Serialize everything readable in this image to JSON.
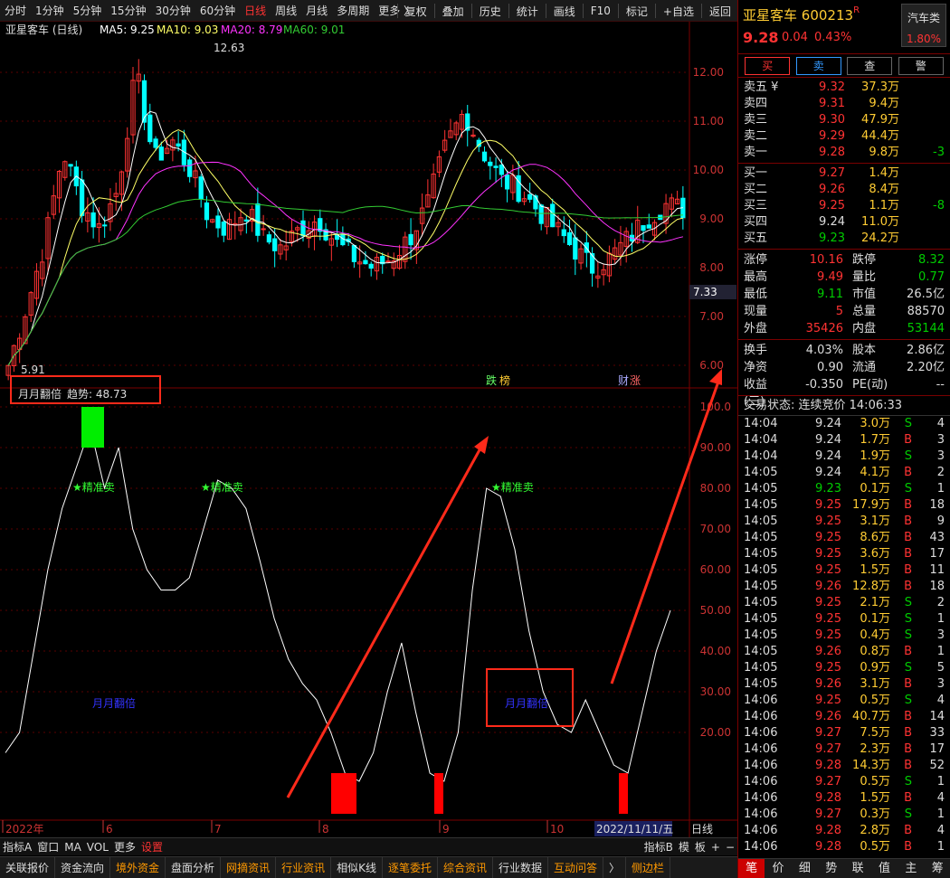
{
  "toolbar": {
    "periods": [
      "分时",
      "1分钟",
      "5分钟",
      "15分钟",
      "30分钟",
      "60分钟",
      "日线",
      "周线",
      "月线",
      "多周期",
      "更多 〉"
    ],
    "active_period": "日线",
    "actions": [
      "复权",
      "叠加",
      "历史",
      "统计",
      "画线",
      "F10",
      "标记",
      "+自选",
      "返回"
    ]
  },
  "chart_title": {
    "name": "亚星客车 (日线)",
    "ma5": "MA5: 9.25",
    "ma10": "MA10: 9.03",
    "ma20": "MA20: 8.79",
    "ma60": "MA60: 9.01"
  },
  "indicator_title": {
    "name": "月月翻倍",
    "trend": "趋势: 48.73"
  },
  "chart_labels": {
    "high": "12.63",
    "low": "5.91",
    "last_tag": "7.33",
    "sell1": "★精准卖",
    "sell2": "★精准卖",
    "sell3": "★精准卖",
    "ind1": "月月翻倍",
    "ind2": "月月翻倍",
    "news1": "跌",
    "news2": "榜",
    "news3": "财",
    "news4": "涨"
  },
  "xaxis": {
    "labels": [
      "2022年",
      "6",
      "7",
      "8",
      "9",
      "10"
    ],
    "date_box": "2022/11/11/五",
    "period": "日线"
  },
  "price_axis": [
    "12.00",
    "11.00",
    "10.00",
    "9.00",
    "8.00",
    "7.00",
    "6.00"
  ],
  "ind_axis": [
    "100.0",
    "90.00",
    "80.00",
    "70.00",
    "60.00",
    "50.00",
    "40.00",
    "30.00",
    "20.00"
  ],
  "colors": {
    "up": "#ff3333",
    "down": "#00ffff",
    "ma5": "#ffffff",
    "ma10": "#ffff66",
    "ma20": "#ff33ff",
    "ma60": "#33cc33",
    "annotation": "#ff2a1a"
  },
  "bottom_toolbar": {
    "items": [
      "指标A",
      "窗口",
      "MA",
      "VOL",
      "更多",
      "设置"
    ],
    "right": [
      "指标B",
      "模",
      "板",
      "+",
      "−"
    ]
  },
  "bottom_tabs": [
    "关联报价",
    "资金流向",
    "境外资金",
    "盘面分析",
    "网摘资讯",
    "行业资讯",
    "相似K线",
    "逐笔委托",
    "综合资讯",
    "行业数据",
    "互动问答",
    "〉",
    "侧边栏"
  ],
  "quote": {
    "name": "亚星客车",
    "code": "600213",
    "badge": "R",
    "price": "9.28",
    "change": "0.04",
    "pct": "0.43%",
    "industry": "汽车类",
    "industry_pct": "1.80%",
    "buttons": [
      "买",
      "卖",
      "查",
      "警"
    ]
  },
  "asks": [
    {
      "label": "卖五 ¥",
      "price": "9.32",
      "vol": "37.3万",
      "chg": ""
    },
    {
      "label": "卖四",
      "price": "9.31",
      "vol": "9.4万",
      "chg": ""
    },
    {
      "label": "卖三",
      "price": "9.30",
      "vol": "47.9万",
      "chg": ""
    },
    {
      "label": "卖二",
      "price": "9.29",
      "vol": "44.4万",
      "chg": ""
    },
    {
      "label": "卖一",
      "price": "9.28",
      "vol": "9.8万",
      "chg": "-3"
    }
  ],
  "bids": [
    {
      "label": "买一",
      "price": "9.27",
      "vol": "1.4万",
      "chg": ""
    },
    {
      "label": "买二",
      "price": "9.26",
      "vol": "8.4万",
      "chg": ""
    },
    {
      "label": "买三",
      "price": "9.25",
      "vol": "1.1万",
      "chg": "-8"
    },
    {
      "label": "买四",
      "price": "9.24",
      "vol": "11.0万",
      "chg": ""
    },
    {
      "label": "买五",
      "price": "9.23",
      "vol": "24.2万",
      "chg": ""
    }
  ],
  "stats": [
    {
      "k": "涨停",
      "v": "10.16",
      "vc": "red",
      "k2": "跌停",
      "v2": "8.32",
      "v2c": "green"
    },
    {
      "k": "最高",
      "v": "9.49",
      "vc": "red",
      "k2": "量比",
      "v2": "0.77",
      "v2c": "green"
    },
    {
      "k": "最低",
      "v": "9.11",
      "vc": "green",
      "k2": "市值",
      "v2": "26.5亿",
      "v2c": "white"
    },
    {
      "k": "现量",
      "v": "5",
      "vc": "red",
      "k2": "总量",
      "v2": "88570",
      "v2c": "white"
    },
    {
      "k": "外盘",
      "v": "35426",
      "vc": "red",
      "k2": "内盘",
      "v2": "53144",
      "v2c": "green"
    }
  ],
  "stats2": [
    {
      "k": "换手",
      "v": "4.03%",
      "k2": "股本",
      "v2": "2.86亿"
    },
    {
      "k": "净资",
      "v": "0.90",
      "k2": "流通",
      "v2": "2.20亿"
    },
    {
      "k": "收益(三)",
      "v": "-0.350",
      "k2": "PE(动)",
      "v2": "--"
    }
  ],
  "trades_title": "交易状态: 连续竞价 14:06:33",
  "trades": [
    [
      "14:04",
      "9.24",
      "3.0万",
      "S",
      "4"
    ],
    [
      "14:04",
      "9.24",
      "1.7万",
      "B",
      "3"
    ],
    [
      "14:04",
      "9.24",
      "1.9万",
      "S",
      "3"
    ],
    [
      "14:05",
      "9.24",
      "4.1万",
      "B",
      "2"
    ],
    [
      "14:05",
      "9.23",
      "0.1万",
      "S",
      "1"
    ],
    [
      "14:05",
      "9.25",
      "17.9万",
      "B",
      "18"
    ],
    [
      "14:05",
      "9.25",
      "3.1万",
      "B",
      "9"
    ],
    [
      "14:05",
      "9.25",
      "8.6万",
      "B",
      "43"
    ],
    [
      "14:05",
      "9.25",
      "3.6万",
      "B",
      "17"
    ],
    [
      "14:05",
      "9.25",
      "1.5万",
      "B",
      "11"
    ],
    [
      "14:05",
      "9.26",
      "12.8万",
      "B",
      "18"
    ],
    [
      "14:05",
      "9.25",
      "2.1万",
      "S",
      "2"
    ],
    [
      "14:05",
      "9.25",
      "0.1万",
      "S",
      "1"
    ],
    [
      "14:05",
      "9.25",
      "0.4万",
      "S",
      "3"
    ],
    [
      "14:05",
      "9.26",
      "0.8万",
      "B",
      "1"
    ],
    [
      "14:05",
      "9.25",
      "0.9万",
      "S",
      "5"
    ],
    [
      "14:05",
      "9.26",
      "3.1万",
      "B",
      "3"
    ],
    [
      "14:06",
      "9.25",
      "0.5万",
      "S",
      "4"
    ],
    [
      "14:06",
      "9.26",
      "40.7万",
      "B",
      "14"
    ],
    [
      "14:06",
      "9.27",
      "7.5万",
      "B",
      "33"
    ],
    [
      "14:06",
      "9.27",
      "2.3万",
      "B",
      "17"
    ],
    [
      "14:06",
      "9.28",
      "14.3万",
      "B",
      "52"
    ],
    [
      "14:06",
      "9.27",
      "0.5万",
      "S",
      "1"
    ],
    [
      "14:06",
      "9.28",
      "1.5万",
      "B",
      "4"
    ],
    [
      "14:06",
      "9.27",
      "0.3万",
      "S",
      "1"
    ],
    [
      "14:06",
      "9.28",
      "2.8万",
      "B",
      "4"
    ],
    [
      "14:06",
      "9.28",
      "0.5万",
      "B",
      "1"
    ]
  ],
  "rp_foot": [
    "笔",
    "价",
    "细",
    "势",
    "联",
    "值",
    "主",
    "筹"
  ],
  "chart_data": {
    "type": "candlestick",
    "ma_values": {
      "MA5": 9.25,
      "MA10": 9.03,
      "MA20": 8.79,
      "MA60": 9.01
    },
    "price_high": 12.63,
    "price_low": 5.91,
    "ylim": [
      6,
      12.5
    ],
    "indicator": {
      "name": "月月翻倍",
      "trend": 48.73,
      "ylim": [
        0,
        100
      ]
    }
  }
}
